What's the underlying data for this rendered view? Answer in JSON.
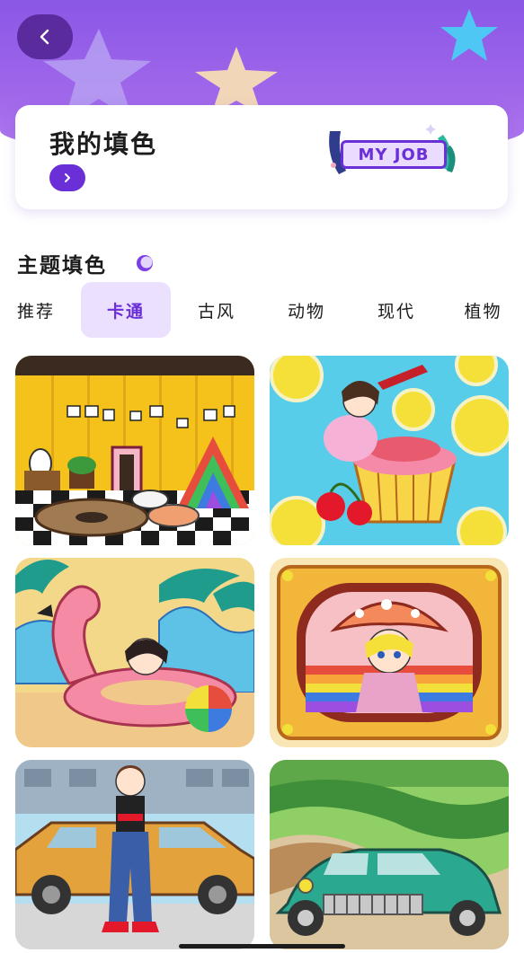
{
  "header": {
    "back_icon": "chevron-left-icon"
  },
  "my_card": {
    "title": "我的填色",
    "badge": "MY JOB",
    "go_icon": "chevron-right-icon"
  },
  "section": {
    "title": "主题填色"
  },
  "tabs": [
    {
      "label": "推荐",
      "active": false
    },
    {
      "label": "卡通",
      "active": true
    },
    {
      "label": "古风",
      "active": false
    },
    {
      "label": "动物",
      "active": false
    },
    {
      "label": "现代",
      "active": false
    },
    {
      "label": "植物",
      "active": false
    }
  ],
  "colors": {
    "accent": "#6a2fd6",
    "header": "#8a57e6",
    "tab_active_bg": "#ece0ff"
  },
  "artworks": [
    {
      "subject": "cartoon-room"
    },
    {
      "subject": "girl-on-dessert"
    },
    {
      "subject": "flamingo-float-girl"
    },
    {
      "subject": "mushroom-girl"
    },
    {
      "subject": "girl-with-taxi"
    },
    {
      "subject": "vintage-car-road"
    }
  ]
}
